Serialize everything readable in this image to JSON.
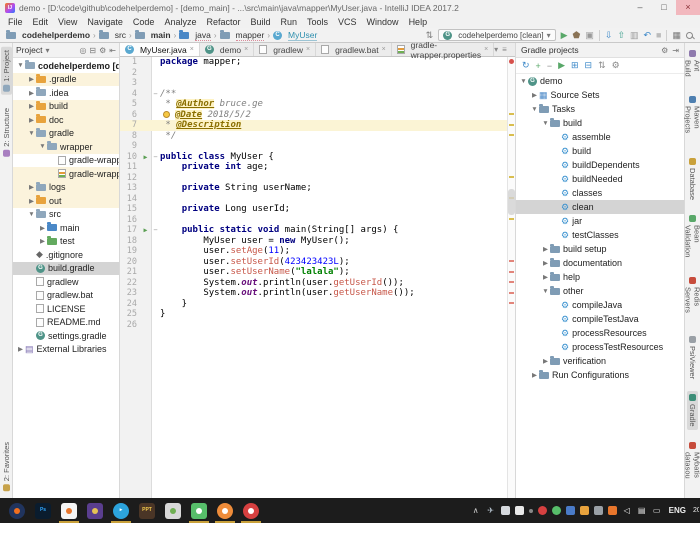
{
  "window": {
    "title": "demo - [D:\\code\\github\\codehelperdemo] - [demo_main] - ...\\src\\main\\java\\mapper\\MyUser.java - IntelliJ IDEA 2017.2",
    "logo": "IJ",
    "minimize": "–",
    "maximize": "□",
    "close": "×"
  },
  "menu": {
    "items": [
      "File",
      "Edit",
      "View",
      "Navigate",
      "Code",
      "Analyze",
      "Refactor",
      "Build",
      "Run",
      "Tools",
      "VCS",
      "Window",
      "Help"
    ]
  },
  "navbar": {
    "breadcrumbs": [
      {
        "label": "codehelperdemo",
        "icon": {
          "t": "folder",
          "c": "#7F9CB5"
        },
        "bold": true
      },
      {
        "label": "src",
        "icon": {
          "t": "folder",
          "c": "#7F9CB5"
        }
      },
      {
        "label": "main",
        "icon": {
          "t": "folder",
          "c": "#7F9CB5"
        },
        "bold": true
      },
      {
        "label": "java",
        "icon": {
          "t": "folder",
          "c": "#4A88C7"
        },
        "u": true
      },
      {
        "label": "mapper",
        "icon": {
          "t": "folder",
          "c": "#7F9CB5"
        },
        "u": true
      },
      {
        "label": "MyUser",
        "icon": {
          "t": "class"
        },
        "accent": true
      }
    ],
    "run_config": "codehelperdemo [clean]"
  },
  "left_strip": {
    "items": [
      {
        "label": "1: Project",
        "color": "#8FA7BC",
        "active": true
      },
      {
        "label": "2: Structure",
        "color": "#A87FC0"
      },
      {
        "label": "2: Favorites",
        "color": "#C7A24A",
        "bottom": true
      }
    ]
  },
  "right_strip": {
    "items": [
      {
        "label": "Ant Build",
        "color": "#8F7AAE"
      },
      {
        "label": "Maven Projects",
        "color": "#4E7FB0"
      },
      {
        "label": "Database",
        "color": "#C9A13B"
      },
      {
        "label": "Bean Validation",
        "color": "#59A869"
      },
      {
        "label": "Redis Servers",
        "color": "#C74C3C"
      },
      {
        "label": "PsiViewer",
        "color": "#9AA0A6"
      },
      {
        "label": "Gradle",
        "color": "#3D8E78",
        "active": true
      },
      {
        "label": "Mybatis datasou",
        "color": "#C74C3C",
        "bottom": true
      }
    ]
  },
  "project_panel": {
    "header": "Project",
    "tree": [
      {
        "label": "codehelperdemo [demo]",
        "depth": 0,
        "ch": "v",
        "icon": {
          "t": "folder",
          "c": "#8FA7BC"
        },
        "bold": true
      },
      {
        "label": ".gradle",
        "depth": 1,
        "ch": ">",
        "icon": {
          "t": "folder",
          "c": "#E8A33D"
        },
        "tint": true
      },
      {
        "label": ".idea",
        "depth": 1,
        "ch": ">",
        "icon": {
          "t": "folder",
          "c": "#8FA7BC"
        }
      },
      {
        "label": "build",
        "depth": 1,
        "ch": ">",
        "icon": {
          "t": "folder",
          "c": "#E8A33D"
        },
        "tint": true
      },
      {
        "label": "doc",
        "depth": 1,
        "ch": ">",
        "icon": {
          "t": "folder",
          "c": "#E8A33D"
        },
        "tint": true
      },
      {
        "label": "gradle",
        "depth": 1,
        "ch": "v",
        "icon": {
          "t": "folder",
          "c": "#8FA7BC"
        },
        "tint": true
      },
      {
        "label": "wrapper",
        "depth": 2,
        "ch": "v",
        "icon": {
          "t": "folder",
          "c": "#8FA7BC"
        },
        "tint": true
      },
      {
        "label": "gradle-wrapper.jar",
        "depth": 3,
        "ch": "",
        "icon": {
          "t": "file"
        }
      },
      {
        "label": "gradle-wrapper.properties",
        "depth": 3,
        "ch": "",
        "icon": {
          "t": "props"
        },
        "tint": true
      },
      {
        "label": "logs",
        "depth": 1,
        "ch": ">",
        "icon": {
          "t": "folder",
          "c": "#8FA7BC"
        },
        "tint": true
      },
      {
        "label": "out",
        "depth": 1,
        "ch": ">",
        "icon": {
          "t": "folder",
          "c": "#E8A33D"
        },
        "tint": true
      },
      {
        "label": "src",
        "depth": 1,
        "ch": "v",
        "icon": {
          "t": "folder",
          "c": "#8FA7BC"
        }
      },
      {
        "label": "main",
        "depth": 2,
        "ch": ">",
        "icon": {
          "t": "folder",
          "c": "#4A88C7"
        }
      },
      {
        "label": "test",
        "depth": 2,
        "ch": ">",
        "icon": {
          "t": "folder",
          "c": "#63AA5F"
        }
      },
      {
        "label": ".gitignore",
        "depth": 1,
        "ch": "",
        "icon": {
          "t": "glyph",
          "g": "◆",
          "c": "#666666"
        }
      },
      {
        "label": "build.gradle",
        "depth": 1,
        "ch": "",
        "icon": {
          "t": "gradle"
        },
        "sel": true
      },
      {
        "label": "gradlew",
        "depth": 1,
        "ch": "",
        "icon": {
          "t": "file"
        }
      },
      {
        "label": "gradlew.bat",
        "depth": 1,
        "ch": "",
        "icon": {
          "t": "file"
        }
      },
      {
        "label": "LICENSE",
        "depth": 1,
        "ch": "",
        "icon": {
          "t": "file"
        }
      },
      {
        "label": "README.md",
        "depth": 1,
        "ch": "",
        "icon": {
          "t": "file"
        }
      },
      {
        "label": "settings.gradle",
        "depth": 1,
        "ch": "",
        "icon": {
          "t": "gradle"
        }
      },
      {
        "label": "External Libraries",
        "depth": 0,
        "ch": ">",
        "icon": {
          "t": "glyph",
          "g": "▤",
          "c": "#7A6AAE"
        }
      }
    ]
  },
  "editor": {
    "tabs": [
      {
        "label": "MyUser.java",
        "icon": {
          "t": "class"
        },
        "active": true
      },
      {
        "label": "demo",
        "icon": {
          "t": "gradle"
        }
      },
      {
        "label": "gradlew",
        "icon": {
          "t": "file"
        }
      },
      {
        "label": "gradlew.bat",
        "icon": {
          "t": "file"
        }
      },
      {
        "label": "gradle-wrapper.properties",
        "icon": {
          "t": "props"
        }
      }
    ],
    "lines": [
      {
        "n": 1,
        "tk": [
          [
            "kw",
            "package"
          ],
          [
            "pl",
            " mapper;"
          ]
        ]
      },
      {
        "n": 2,
        "tk": []
      },
      {
        "n": 3,
        "tk": []
      },
      {
        "n": 4,
        "tk": [
          [
            "cm",
            "/**"
          ]
        ],
        "fold": "−"
      },
      {
        "n": 5,
        "tk": [
          [
            "cm",
            " * "
          ],
          [
            "tag",
            "@Author"
          ],
          [
            "cmi",
            " bruce.ge"
          ]
        ]
      },
      {
        "n": 6,
        "tk": [
          [
            "bulb",
            ""
          ],
          [
            "tag",
            "@Date"
          ],
          [
            "cmi",
            " 2018/5/2"
          ]
        ]
      },
      {
        "n": 7,
        "tk": [
          [
            "cm",
            " * "
          ],
          [
            "tag",
            "@Description"
          ]
        ],
        "hl": true
      },
      {
        "n": 8,
        "tk": [
          [
            "cm",
            " */"
          ]
        ]
      },
      {
        "n": 9,
        "tk": []
      },
      {
        "n": 10,
        "tk": [
          [
            "kw",
            "public"
          ],
          [
            "pl",
            " "
          ],
          [
            "kw",
            "class"
          ],
          [
            "pl",
            " MyUser {"
          ]
        ],
        "run": true,
        "fold": "−"
      },
      {
        "n": 11,
        "tk": [
          [
            "pl",
            "    "
          ],
          [
            "kw",
            "private"
          ],
          [
            "pl",
            " "
          ],
          [
            "kw",
            "int"
          ],
          [
            "pl",
            " age;"
          ]
        ]
      },
      {
        "n": 12,
        "tk": []
      },
      {
        "n": 13,
        "tk": [
          [
            "pl",
            "    "
          ],
          [
            "kw",
            "private"
          ],
          [
            "pl",
            " String userName;"
          ]
        ]
      },
      {
        "n": 14,
        "tk": []
      },
      {
        "n": 15,
        "tk": [
          [
            "pl",
            "    "
          ],
          [
            "kw",
            "private"
          ],
          [
            "pl",
            " Long userId;"
          ]
        ]
      },
      {
        "n": 16,
        "tk": []
      },
      {
        "n": 17,
        "tk": [
          [
            "pl",
            "    "
          ],
          [
            "kw",
            "public"
          ],
          [
            "pl",
            " "
          ],
          [
            "kw",
            "static"
          ],
          [
            "pl",
            " "
          ],
          [
            "kw",
            "void"
          ],
          [
            "pl",
            " main(String[] args) {"
          ]
        ],
        "run": true,
        "fold": "−"
      },
      {
        "n": 18,
        "tk": [
          [
            "pl",
            "        MyUser user = "
          ],
          [
            "kw",
            "new"
          ],
          [
            "pl",
            " MyUser();"
          ]
        ]
      },
      {
        "n": 19,
        "tk": [
          [
            "pl",
            "        user."
          ],
          [
            "err",
            "setAge"
          ],
          [
            "pl",
            "("
          ],
          [
            "num",
            "11"
          ],
          [
            "pl",
            ");"
          ]
        ]
      },
      {
        "n": 20,
        "tk": [
          [
            "pl",
            "        user."
          ],
          [
            "err",
            "setUserId"
          ],
          [
            "pl",
            "("
          ],
          [
            "num",
            "423423423L"
          ],
          [
            "pl",
            ");"
          ]
        ]
      },
      {
        "n": 21,
        "tk": [
          [
            "pl",
            "        user."
          ],
          [
            "err",
            "setUserName"
          ],
          [
            "pl",
            "("
          ],
          [
            "str",
            "\"lalala\""
          ],
          [
            "pl",
            ");"
          ]
        ]
      },
      {
        "n": 22,
        "tk": [
          [
            "pl",
            "        System."
          ],
          [
            "fld",
            "out"
          ],
          [
            "pl",
            ".println(user."
          ],
          [
            "err",
            "getUserId"
          ],
          [
            "pl",
            "());"
          ]
        ]
      },
      {
        "n": 23,
        "tk": [
          [
            "pl",
            "        System."
          ],
          [
            "fld",
            "out"
          ],
          [
            "pl",
            ".println(user."
          ],
          [
            "err",
            "getUserName"
          ],
          [
            "pl",
            "());"
          ]
        ]
      },
      {
        "n": 24,
        "tk": [
          [
            "pl",
            "    }"
          ]
        ]
      },
      {
        "n": 25,
        "tk": [
          [
            "pl",
            "}"
          ]
        ]
      },
      {
        "n": 26,
        "tk": []
      }
    ],
    "stripe": {
      "warn_lines": [
        5,
        6,
        7,
        11,
        13,
        15
      ],
      "error_lines": [
        19,
        20,
        21,
        22,
        23
      ],
      "warn_color": "#D9BE4F",
      "error_color": "#E2857B"
    }
  },
  "gradle_panel": {
    "title": "Gradle projects",
    "tree": [
      {
        "label": "demo",
        "depth": 0,
        "ch": "v",
        "icon": {
          "t": "gradle"
        }
      },
      {
        "label": "Source Sets",
        "depth": 1,
        "ch": ">",
        "icon": {
          "t": "glyph",
          "g": "▦",
          "c": "#4A88C7"
        }
      },
      {
        "label": "Tasks",
        "depth": 1,
        "ch": "v",
        "icon": {
          "t": "folder",
          "c": "#7F9CB5"
        }
      },
      {
        "label": "build",
        "depth": 2,
        "ch": "v",
        "icon": {
          "t": "folder",
          "c": "#7F9CB5"
        }
      },
      {
        "label": "assemble",
        "depth": 3,
        "ch": "",
        "icon": {
          "t": "task"
        }
      },
      {
        "label": "build",
        "depth": 3,
        "ch": "",
        "icon": {
          "t": "task"
        }
      },
      {
        "label": "buildDependents",
        "depth": 3,
        "ch": "",
        "icon": {
          "t": "task"
        }
      },
      {
        "label": "buildNeeded",
        "depth": 3,
        "ch": "",
        "icon": {
          "t": "task"
        }
      },
      {
        "label": "classes",
        "depth": 3,
        "ch": "",
        "icon": {
          "t": "task"
        }
      },
      {
        "label": "clean",
        "depth": 3,
        "ch": "",
        "icon": {
          "t": "task"
        },
        "sel": true
      },
      {
        "label": "jar",
        "depth": 3,
        "ch": "",
        "icon": {
          "t": "task"
        }
      },
      {
        "label": "testClasses",
        "depth": 3,
        "ch": "",
        "icon": {
          "t": "task"
        }
      },
      {
        "label": "build setup",
        "depth": 2,
        "ch": ">",
        "icon": {
          "t": "folder",
          "c": "#7F9CB5"
        }
      },
      {
        "label": "documentation",
        "depth": 2,
        "ch": ">",
        "icon": {
          "t": "folder",
          "c": "#7F9CB5"
        }
      },
      {
        "label": "help",
        "depth": 2,
        "ch": ">",
        "icon": {
          "t": "folder",
          "c": "#7F9CB5"
        }
      },
      {
        "label": "other",
        "depth": 2,
        "ch": "v",
        "icon": {
          "t": "folder",
          "c": "#7F9CB5"
        }
      },
      {
        "label": "compileJava",
        "depth": 3,
        "ch": "",
        "icon": {
          "t": "task"
        }
      },
      {
        "label": "compileTestJava",
        "depth": 3,
        "ch": "",
        "icon": {
          "t": "task"
        }
      },
      {
        "label": "processResources",
        "depth": 3,
        "ch": "",
        "icon": {
          "t": "task"
        }
      },
      {
        "label": "processTestResources",
        "depth": 3,
        "ch": "",
        "icon": {
          "t": "task"
        }
      },
      {
        "label": "verification",
        "depth": 2,
        "ch": ">",
        "icon": {
          "t": "folder",
          "c": "#7F9CB5"
        }
      },
      {
        "label": "Run Configurations",
        "depth": 1,
        "ch": ">",
        "icon": {
          "t": "folder",
          "c": "#7F9CB5"
        }
      }
    ]
  },
  "taskbar": {
    "apps": [
      {
        "name": "firefox-icon",
        "shape": "circle",
        "bg": "#20345E",
        "accent": "#F06F1F",
        "running": false
      },
      {
        "name": "photoshop-icon",
        "shape": "square",
        "bg": "#0A1C2E",
        "label": "Ps",
        "lc": "#31A8FF",
        "running": false
      },
      {
        "name": "orange-doc-icon",
        "shape": "square",
        "bg": "#F5F5F5",
        "accent": "#E8762C",
        "running": true
      },
      {
        "name": "star-app-icon",
        "shape": "square",
        "bg": "#5A3E8E",
        "accent": "#E5C355",
        "running": false
      },
      {
        "name": "telegram-icon",
        "shape": "circle",
        "bg": "#2CA3DC",
        "label": "▸",
        "lc": "#FFFFFF",
        "running": true
      },
      {
        "name": "ppt-app-icon",
        "shape": "square",
        "bg": "#4A3526",
        "label": "PPT",
        "lc": "#F2C94C",
        "running": false
      },
      {
        "name": "photos-app-icon",
        "shape": "square",
        "bg": "#D8D8D8",
        "accent": "#6FAF52",
        "running": false
      },
      {
        "name": "wechat-icon",
        "shape": "square",
        "bg": "#57BE6A",
        "accent": "#FFFFFF",
        "running": true
      },
      {
        "name": "orange-app-icon",
        "shape": "circle",
        "bg": "#EE8C3A",
        "accent": "#FFFFFF",
        "running": true
      },
      {
        "name": "red-app-icon",
        "shape": "circle",
        "bg": "#D64040",
        "accent": "#FFFFFF",
        "running": true
      }
    ],
    "tray": [
      {
        "name": "tray-expand-icon",
        "kind": "glyph",
        "g": "∧",
        "c": "#CCCCCC"
      },
      {
        "name": "telegram-tray-icon",
        "kind": "glyph",
        "g": "✈",
        "c": "#B9C6D2"
      },
      {
        "name": "shield-icon",
        "kind": "sq",
        "c": "#D6D9DE"
      },
      {
        "name": "flag-icon",
        "kind": "sq",
        "c": "#E8E8E8"
      },
      {
        "name": "dot-icon",
        "kind": "dot",
        "c": "#888888"
      },
      {
        "name": "red-tray-icon",
        "kind": "round",
        "c": "#D64040"
      },
      {
        "name": "wechat-tray-icon",
        "kind": "round",
        "c": "#57BE6A"
      },
      {
        "name": "blue-doc-icon",
        "kind": "sq",
        "c": "#4A7BC8"
      },
      {
        "name": "java-tray-icon",
        "kind": "sq",
        "c": "#E8A33D"
      },
      {
        "name": "runner-icon",
        "kind": "sq",
        "c": "#9AA0A6"
      },
      {
        "name": "orange-tray-doc-icon",
        "kind": "sq",
        "c": "#E8762C"
      },
      {
        "name": "volume-icon",
        "kind": "glyph",
        "g": "◁",
        "c": "#EEEEEE"
      },
      {
        "name": "keyboard-icon",
        "kind": "glyph",
        "g": "▤",
        "c": "#EEEEEE"
      },
      {
        "name": "touch-keyboard-icon",
        "kind": "glyph",
        "g": "▭",
        "c": "#EEEEEE"
      }
    ],
    "lang": "ENG",
    "clock": "20"
  }
}
